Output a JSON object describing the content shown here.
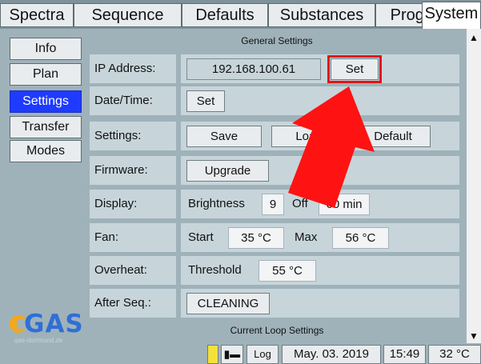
{
  "tabs": [
    "Spectra",
    "Sequence",
    "Defaults",
    "Substances",
    "Programs",
    "System"
  ],
  "active_tab": "System",
  "nav": {
    "items": [
      "Info",
      "Plan",
      "Settings",
      "Transfer",
      "Modes"
    ],
    "active": "Settings"
  },
  "logo": {
    "text": "GAS",
    "url": "gas-dortmund.de"
  },
  "general": {
    "header": "General Settings",
    "ip": {
      "label": "IP Address:",
      "value": "192.168.100.61",
      "button": "Set"
    },
    "datetime": {
      "label": "Date/Time:",
      "button": "Set"
    },
    "settings": {
      "label": "Settings:",
      "save": "Save",
      "load": "Load",
      "default": "Default"
    },
    "firmware": {
      "label": "Firmware:",
      "button": "Upgrade"
    },
    "display": {
      "label": "Display:",
      "brightness_label": "Brightness",
      "brightness": "9",
      "off_label": "Off",
      "off_value": "60 min"
    },
    "fan": {
      "label": "Fan:",
      "start_label": "Start",
      "start_value": "35 °C",
      "max_label": "Max",
      "max_value": "56 °C"
    },
    "overheat": {
      "label": "Overheat:",
      "threshold_label": "Threshold",
      "threshold_value": "55 °C"
    },
    "after_seq": {
      "label": "After Seq.:",
      "value": "CLEANING"
    }
  },
  "loop": {
    "header": "Current Loop Settings"
  },
  "status": {
    "log": "Log",
    "date": "May. 03. 2019",
    "time": "15:49",
    "temp": "32 °C"
  },
  "colors": {
    "background": "#9fb2ba",
    "row": "#c7d5db",
    "active_nav": "#1e3bff",
    "highlight": "#e01515",
    "arrow": "#ff1212",
    "logo_blue": "#2f6fd6",
    "logo_orange": "#f3a81c"
  },
  "icons": [
    "battery-icon",
    "plug-icon",
    "scroll-up-icon",
    "scroll-down-icon"
  ]
}
